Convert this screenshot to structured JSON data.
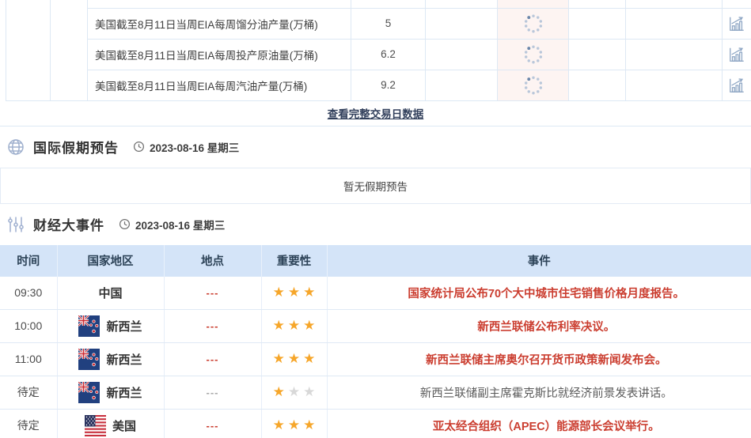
{
  "top_table": {
    "rows": [
      {
        "name": "美国截至8月11日当周EIA每周馏分油产量(万桶)",
        "value": "5",
        "status": "loading"
      },
      {
        "name": "美国截至8月11日当周EIA每周投产原油量(万桶)",
        "value": "6.2",
        "status": "loading"
      },
      {
        "name": "美国截至8月11日当周EIA每周汽油产量(万桶)",
        "value": "9.2",
        "status": "loading"
      }
    ],
    "view_all_label": "查看完整交易日数据"
  },
  "holiday_section": {
    "title": "国际假期预告",
    "date": "2023-08-16 星期三",
    "empty_message": "暂无假期预告"
  },
  "events_section": {
    "title": "财经大事件",
    "date": "2023-08-16 星期三",
    "columns": {
      "time": "时间",
      "country": "国家地区",
      "location": "地点",
      "importance": "重要性",
      "event": "事件"
    },
    "rows": [
      {
        "time": "09:30",
        "country": "中国",
        "flag": "none",
        "location": "---",
        "stars": 3,
        "event": "国家统计局公布70个大中城市住宅销售价格月度报告。",
        "highlight": true
      },
      {
        "time": "10:00",
        "country": "新西兰",
        "flag": "nz",
        "location": "---",
        "stars": 3,
        "event": "新西兰联储公布利率决议。",
        "highlight": true
      },
      {
        "time": "11:00",
        "country": "新西兰",
        "flag": "nz",
        "location": "---",
        "stars": 3,
        "event": "新西兰联储主席奥尔召开货币政策新闻发布会。",
        "highlight": true
      },
      {
        "time": "待定",
        "country": "新西兰",
        "flag": "nz",
        "location": "---",
        "stars": 1,
        "event": "新西兰联储副主席霍克斯比就经济前景发表讲话。",
        "highlight": false
      },
      {
        "time": "待定",
        "country": "美国",
        "flag": "us",
        "location": "---",
        "stars": 3,
        "event": "亚太经合组织（APEC）能源部长会议举行。",
        "highlight": true
      }
    ]
  },
  "icons": {
    "holiday_section": "globe-icon",
    "events_section": "sliders-icon",
    "date": "clock-icon",
    "pending_value": "loading-spinner-icon",
    "row_action": "bar-chart-trend-icon"
  },
  "colors": {
    "accent_red": "#cb3e30",
    "star_gold": "#f6a62a",
    "star_gray": "#d8d8d8",
    "table_header_bg": "#d4e4f8",
    "table_border": "#dde8f4",
    "loading_column_bg": "#fdf4f2",
    "link": "#32405c",
    "icon_blue_gray": "#94aac7"
  }
}
